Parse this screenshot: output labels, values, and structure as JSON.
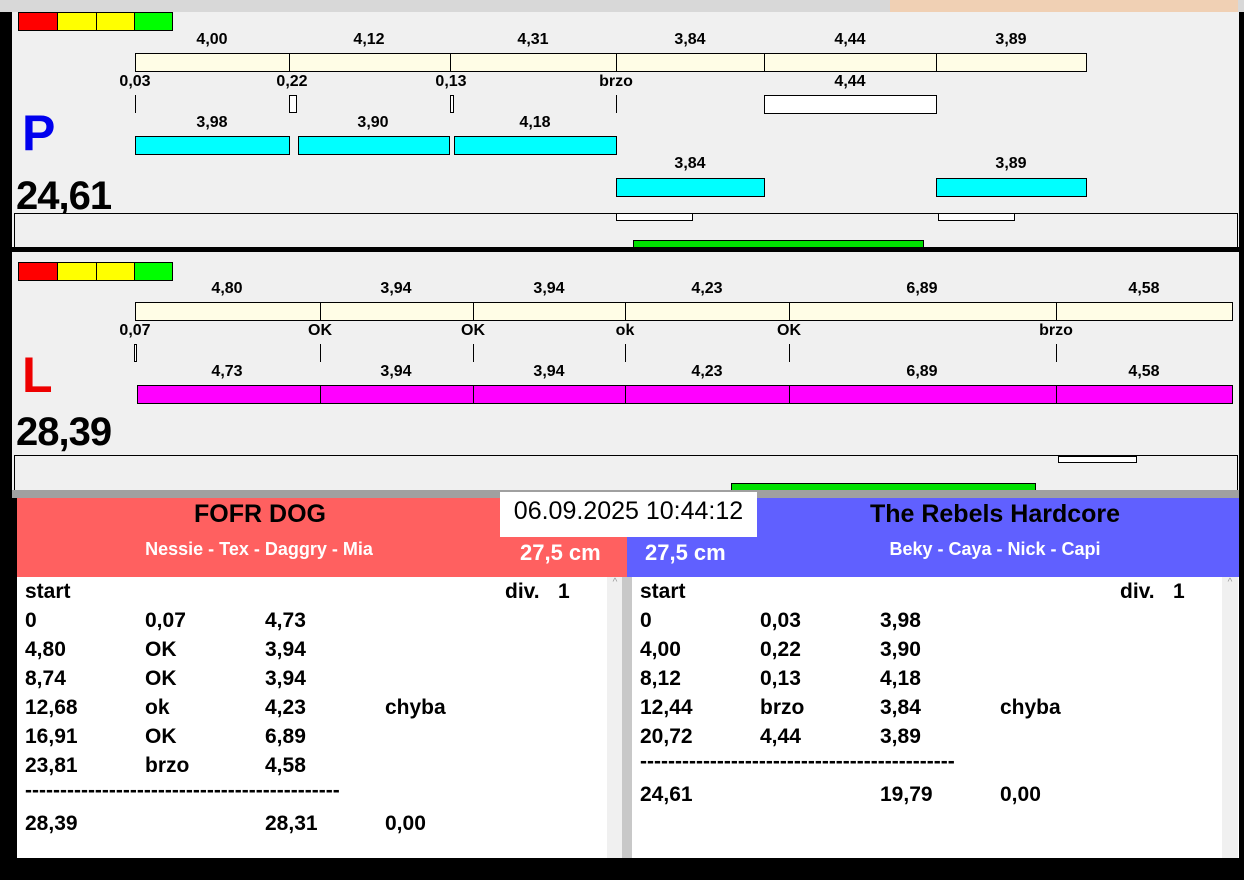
{
  "lanes": {
    "p": {
      "letter": "P",
      "time": "24,61",
      "top_labels": [
        "4,00",
        "4,12",
        "4,31",
        "3,84",
        "4,44",
        "3,89"
      ],
      "mid_labels": [
        "0,03",
        "0,22",
        "0,13",
        "brzo",
        "4,44"
      ],
      "cyan_labels_1": [
        "3,98",
        "3,90",
        "4,18"
      ],
      "cyan_labels_2": [
        "3,84",
        "3,89"
      ]
    },
    "l": {
      "letter": "L",
      "time": "28,39",
      "top_labels": [
        "4,80",
        "3,94",
        "3,94",
        "4,23",
        "6,89",
        "4,58"
      ],
      "mid_labels": [
        "0,07",
        "OK",
        "OK",
        "ok",
        "OK",
        "brzo"
      ],
      "mag_labels": [
        "4,73",
        "3,94",
        "3,94",
        "4,23",
        "6,89",
        "4,58"
      ]
    }
  },
  "colors": {
    "red": "#ff0000",
    "yellow": "#ffff00",
    "green": "#00ff00",
    "team_left": "#ff6060",
    "team_right": "#6060ff"
  },
  "datetime": "06.09.2025 10:44:12",
  "left_team": {
    "name": "FOFR DOG",
    "dogs": "Nessie - Tex - Daggry - Mia",
    "height": "27,5 cm",
    "header": [
      "start",
      "div.",
      "1"
    ],
    "rows": [
      [
        "0",
        "0,07",
        "4,73",
        ""
      ],
      [
        "4,80",
        "OK",
        "3,94",
        ""
      ],
      [
        "8,74",
        "OK",
        "3,94",
        ""
      ],
      [
        "12,68",
        "ok",
        "4,23",
        "chyba"
      ],
      [
        "16,91",
        "OK",
        "6,89",
        ""
      ],
      [
        "23,81",
        "brzo",
        "4,58",
        ""
      ]
    ],
    "separator": "---------------------------------------------",
    "total": [
      "28,39",
      "",
      "28,31",
      "0,00"
    ]
  },
  "right_team": {
    "name": "The Rebels Hardcore",
    "dogs": "Beky - Caya - Nick - Capi",
    "height": "27,5 cm",
    "header": [
      "start",
      "div.",
      "1"
    ],
    "rows": [
      [
        "0",
        "0,03",
        "3,98",
        ""
      ],
      [
        "4,00",
        "0,22",
        "3,90",
        ""
      ],
      [
        "8,12",
        "0,13",
        "4,18",
        ""
      ],
      [
        "12,44",
        "brzo",
        "3,84",
        "chyba"
      ],
      [
        "20,72",
        "4,44",
        "3,89",
        ""
      ]
    ],
    "separator": "---------------------------------------------",
    "total": [
      "24,61",
      "",
      "19,79",
      "0,00"
    ]
  }
}
